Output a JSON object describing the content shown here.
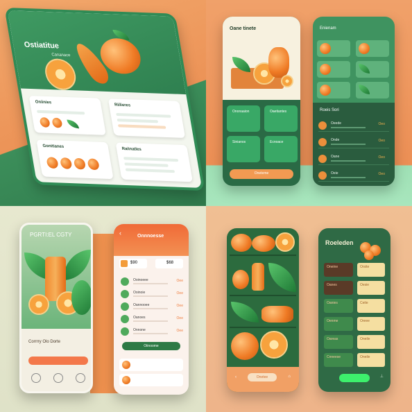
{
  "mockups": {
    "q1": {
      "title": "Ostiatitue",
      "subtitle": "Cananace",
      "cards": [
        {
          "label": "Oniinies"
        },
        {
          "label": "Riilieres"
        },
        {
          "label": "Gonitianes"
        },
        {
          "label": "Raiinatles"
        }
      ]
    },
    "q2": {
      "left_title": "Oane tinete",
      "right_title": "Enienam",
      "tiles": [
        "Ononaaion",
        "Oaetiantes",
        "Sinianos",
        "Ecnoace"
      ],
      "cta": "Oneteme",
      "list_title": "Roeis Sori",
      "list_items": [
        {
          "label": "Oeede",
          "tag": "Oeo"
        },
        {
          "label": "Onde",
          "tag": "Oeo"
        },
        {
          "label": "Oane",
          "tag": "Oeo"
        },
        {
          "label": "Oeie",
          "tag": "Oeo"
        }
      ]
    },
    "q3": {
      "left_title": "PGRTI:EL CGTY",
      "left_footer": "Corrrry Olo Dorte",
      "right_title": "Onnnoesse",
      "stat_a": "$90",
      "stat_b": "$68",
      "items": [
        {
          "label": "Ooinoeee",
          "value": "Oee"
        },
        {
          "label": "Ooinoie",
          "value": "Oee"
        },
        {
          "label": "Oannooee",
          "value": "Oee"
        },
        {
          "label": "Oanoes",
          "value": "Oee"
        },
        {
          "label": "Onnone",
          "value": "Oee"
        }
      ],
      "cta": "Oiinoome"
    },
    "q4": {
      "title": "Roeleden",
      "pill": "Onetee",
      "rows": [
        {
          "a": "Oneine",
          "b": "Orsite"
        },
        {
          "a": "Oanes",
          "b": "Oesie"
        },
        {
          "a": "Oanies",
          "b": "Ceite"
        },
        {
          "a": "Oenme",
          "b": "Oreee"
        },
        {
          "a": "Oareas",
          "b": "Oneile"
        },
        {
          "a": "Cnneese",
          "b": "Oneile"
        }
      ]
    }
  }
}
